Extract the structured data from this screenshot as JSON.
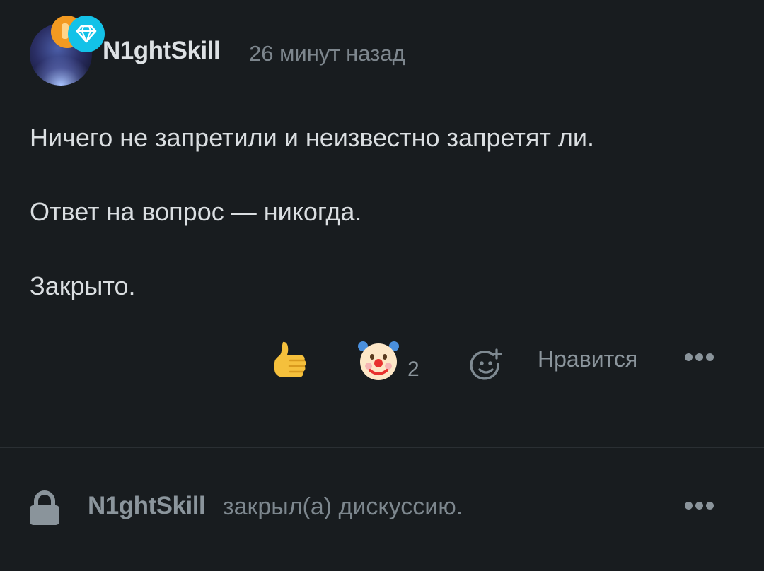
{
  "post": {
    "author": "N1ghtSkill",
    "time": "26 минут назад",
    "paragraphs": [
      "Ничего не запретили и неизвестно запретят ли.",
      "Ответ на вопрос — никогда.",
      "Закрыто."
    ],
    "reactions": {
      "thumbs_up_icon": "thumbs-up-emoji",
      "clown_icon": "clown-face-emoji",
      "clown_count": "2",
      "add_reaction_icon": "add-reaction-icon",
      "like_label": "Нравится"
    }
  },
  "closed_notice": {
    "user": "N1ghtSkill",
    "text": "закрыл(а) дискуссию."
  },
  "colors": {
    "background": "#181c1f",
    "text": "#dadee1",
    "muted": "#7d868d",
    "badge_orange": "#f39a21",
    "badge_cyan": "#13c2e8"
  }
}
